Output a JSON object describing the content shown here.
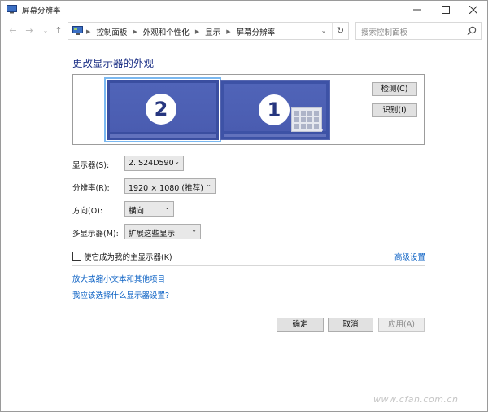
{
  "window": {
    "title": "屏幕分辨率"
  },
  "nav": {
    "crumbs": [
      "控制面板",
      "外观和个性化",
      "显示",
      "屏幕分辨率"
    ],
    "search_placeholder": "搜索控制面板"
  },
  "page_title": "更改显示器的外观",
  "monitors": [
    {
      "number": "2",
      "selected": true
    },
    {
      "number": "1",
      "selected": false
    }
  ],
  "buttons": {
    "detect": "检测(C)",
    "identify": "识别(I)",
    "ok": "确定",
    "cancel": "取消",
    "apply": "应用(A)"
  },
  "fields": {
    "display": {
      "label": "显示器(S):",
      "value": "2. S24D590"
    },
    "resolution": {
      "label": "分辨率(R):",
      "value": "1920 × 1080 (推荐)"
    },
    "orientation": {
      "label": "方向(O):",
      "value": "横向"
    },
    "multiple": {
      "label": "多显示器(M):",
      "value": "扩展这些显示"
    }
  },
  "primary_checkbox": {
    "label": "使它成为我的主显示器(K)",
    "checked": false
  },
  "links": {
    "advanced": "高级设置",
    "text_size": "放大或缩小文本和其他项目",
    "which_settings": "我应该选择什么显示器设置?"
  },
  "watermark": "www.cfan.com.cn",
  "colors": {
    "accent_title": "#1e3287",
    "link": "#0b61c4",
    "monitor": "#3a4ea0",
    "selection": "#7ab8f0"
  }
}
